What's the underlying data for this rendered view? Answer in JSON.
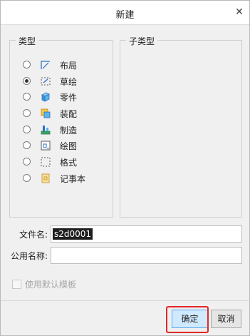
{
  "dialog": {
    "title": "新建"
  },
  "type_group": {
    "label": "类型",
    "items": [
      {
        "label": "布局",
        "icon": "layout-icon",
        "selected": false
      },
      {
        "label": "草绘",
        "icon": "sketch-icon",
        "selected": true
      },
      {
        "label": "零件",
        "icon": "part-icon",
        "selected": false
      },
      {
        "label": "装配",
        "icon": "assembly-icon",
        "selected": false
      },
      {
        "label": "制造",
        "icon": "manufacturing-icon",
        "selected": false
      },
      {
        "label": "绘图",
        "icon": "drawing-icon",
        "selected": false
      },
      {
        "label": "格式",
        "icon": "format-icon",
        "selected": false
      },
      {
        "label": "记事本",
        "icon": "notebook-icon",
        "selected": false
      }
    ]
  },
  "subtype_group": {
    "label": "子类型"
  },
  "fields": {
    "filename_label": "文件名:",
    "filename_value": "s2d0001",
    "common_name_label": "公用名称:",
    "common_name_value": ""
  },
  "options": {
    "use_default_template_label": "使用默认模板"
  },
  "buttons": {
    "ok_label": "确定",
    "cancel_label": "取消"
  },
  "colors": {
    "selected_button_bg": "#cfe9ff",
    "highlight_border": "#e02828"
  }
}
